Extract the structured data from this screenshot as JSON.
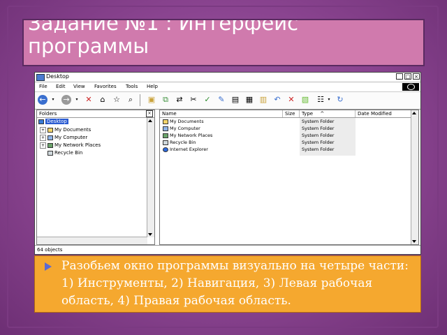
{
  "slide": {
    "title": "Задание №1 : Интерфейс программы",
    "bullet": "Разобьем окно программы визуально на четыре части: 1) Инструменты, 2) Навигация, 3) Левая рабочая область, 4) Правая рабочая область."
  },
  "window": {
    "title": "Desktop",
    "menu": [
      "File",
      "Edit",
      "View",
      "Favorites",
      "Tools",
      "Help"
    ],
    "toolbar_icons": [
      "back-icon",
      "forward-icon",
      "close-icon",
      "home-icon",
      "search-icon",
      "up-folder-icon",
      "folder-icon",
      "copy-icon",
      "move-icon",
      "cut-icon",
      "check-icon",
      "brush-icon",
      "paste-icon",
      "properties-icon",
      "folders-icon",
      "undo-icon",
      "delete-icon",
      "view-icon",
      "refresh-icon"
    ],
    "folders_pane": {
      "header": "Folders",
      "items": [
        {
          "label": "Desktop",
          "icon": "desktop-icon",
          "selected": true
        },
        {
          "label": "My Documents",
          "icon": "documents-icon",
          "expander": "+"
        },
        {
          "label": "My Computer",
          "icon": "computer-icon",
          "expander": "+"
        },
        {
          "label": "My Network Places",
          "icon": "network-icon",
          "expander": "+"
        },
        {
          "label": "Recycle Bin",
          "icon": "recycle-bin-icon",
          "expander": ""
        }
      ]
    },
    "file_list": {
      "columns": [
        "Name",
        "Size",
        "Type",
        "Date Modified"
      ],
      "sort_indicator": "^",
      "rows": [
        {
          "name": "My Documents",
          "size": "",
          "type": "System Folder",
          "modified": "",
          "icon": "documents-icon"
        },
        {
          "name": "My Computer",
          "size": "",
          "type": "System Folder",
          "modified": "",
          "icon": "computer-icon"
        },
        {
          "name": "My Network Places",
          "size": "",
          "type": "System Folder",
          "modified": "",
          "icon": "network-icon"
        },
        {
          "name": "Recycle Bin",
          "size": "",
          "type": "System Folder",
          "modified": "",
          "icon": "recycle-bin-icon"
        },
        {
          "name": "Internet Explorer",
          "size": "",
          "type": "System Folder",
          "modified": "",
          "icon": "ie-icon"
        }
      ]
    },
    "status": "64 objects"
  },
  "colors": {
    "background": "#8a4490",
    "title_box": "#d07aad",
    "bullet_box": "#f5a82f",
    "selection": "#2a5bd1"
  }
}
